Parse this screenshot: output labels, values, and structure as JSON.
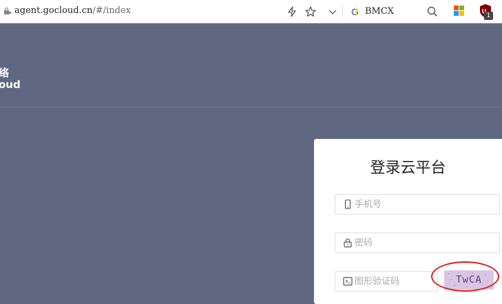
{
  "browser": {
    "url_host": "agent.gocloud.cn",
    "url_path": "/#/index",
    "search_query": "BMCX",
    "search_engine_letter": "G",
    "extension_badge": "1"
  },
  "header": {
    "logo_line1": "络",
    "logo_line2": "oud"
  },
  "login": {
    "title": "登录云平台",
    "phone_placeholder": "手机号",
    "password_placeholder": "密码",
    "captcha_placeholder": "图形验证码",
    "captcha_text": "TwCA"
  },
  "colors": {
    "page_bg": "#5f6880",
    "annotation": "#e21b1b"
  }
}
